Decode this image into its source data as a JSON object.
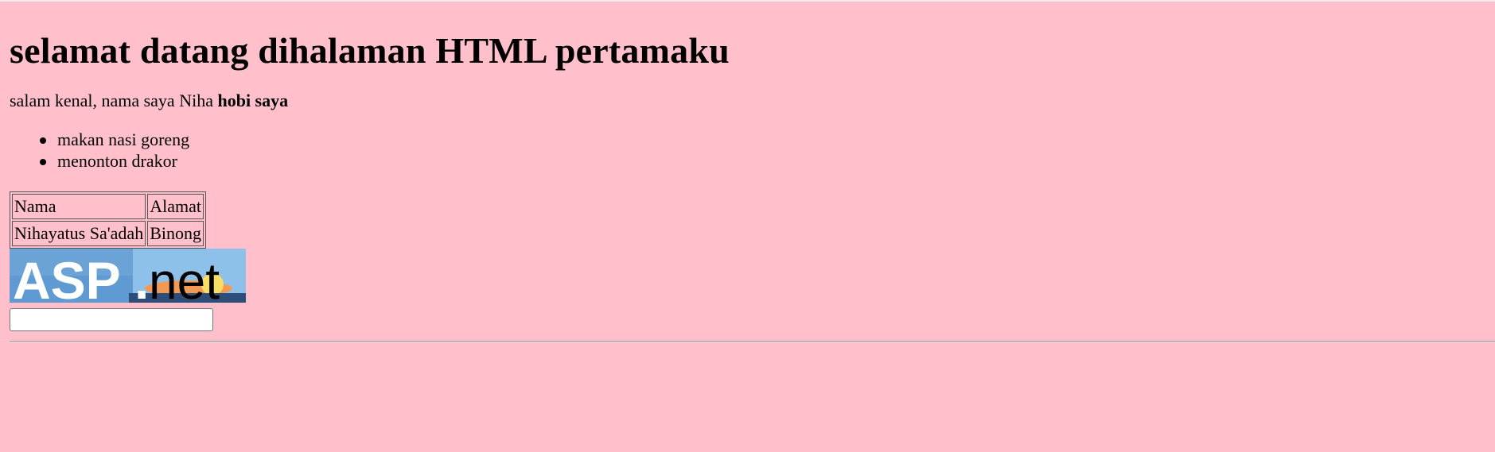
{
  "heading": "selamat datang dihalaman HTML pertamaku",
  "intro": {
    "text": "salam kenal, nama saya Niha ",
    "bold": "hobi saya"
  },
  "hobbies": [
    "makan nasi goreng",
    "menonton drakor"
  ],
  "table": {
    "rows": [
      [
        "Nama",
        "Alamat"
      ],
      [
        "Nihayatus Sa'adah",
        "Binong"
      ]
    ]
  },
  "logo": {
    "text_dark": "ASP",
    "text_dot": ".",
    "text_light": "net",
    "colors": {
      "blue": "#5f9bd2",
      "sky": "#8ec1ea",
      "sunset": "#f29a53",
      "yellow": "#f8de63"
    }
  },
  "input": {
    "value": "",
    "placeholder": ""
  },
  "colors": {
    "background": "#ffc0cb"
  }
}
